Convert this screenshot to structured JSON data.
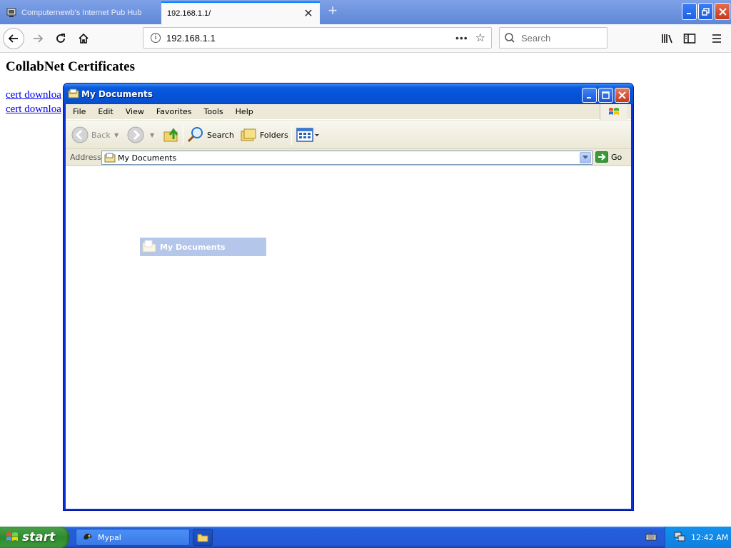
{
  "browser": {
    "tabs": [
      {
        "title": "Computernewb's Internet Pub Hub",
        "active": false
      },
      {
        "title": "192.168.1.1/",
        "active": true
      }
    ],
    "new_tab_symbol": "+",
    "url": "192.168.1.1",
    "page_actions_symbol": "•••",
    "search_placeholder": "Search",
    "icons": [
      "back-icon",
      "forward-icon",
      "reload-icon",
      "home-icon",
      "info-icon",
      "star-icon",
      "search-icon",
      "library-icon",
      "sidebar-icon",
      "menu-icon"
    ]
  },
  "page": {
    "title": "CollabNet Certificates",
    "links": [
      {
        "text": "cert downloa"
      },
      {
        "text": "cert downloa"
      }
    ],
    "link_color": "#0000ee"
  },
  "explorer": {
    "title": "My Documents",
    "menu": [
      "File",
      "Edit",
      "View",
      "Favorites",
      "Tools",
      "Help"
    ],
    "toolbar": {
      "back": "Back",
      "search": "Search",
      "folders": "Folders"
    },
    "address": {
      "label": "Address",
      "value": "My Documents",
      "go": "Go"
    },
    "drag_item": "My Documents",
    "titlebar_color": "#0a5ae0"
  },
  "taskbar": {
    "start": "start",
    "tasks": [
      {
        "label": "Mypal"
      }
    ],
    "clock": "12:42 AM"
  }
}
